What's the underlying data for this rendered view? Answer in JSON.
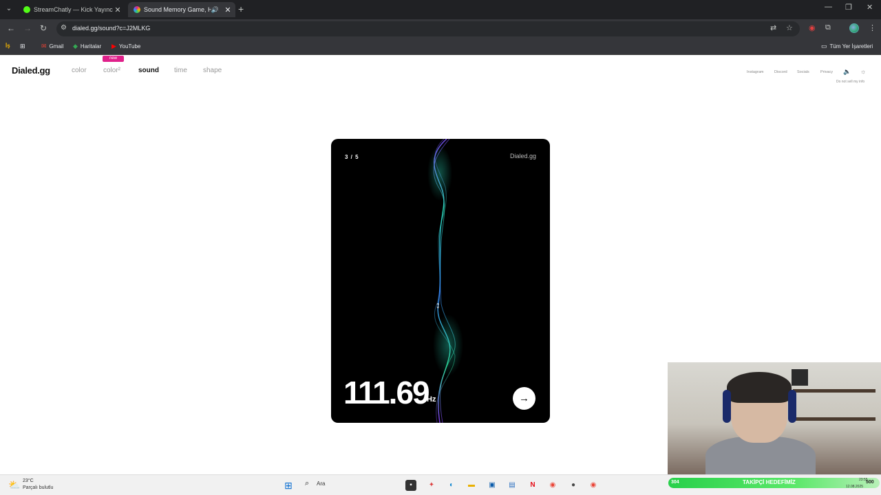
{
  "browser": {
    "tabs": [
      {
        "title": "StreamChatly — Kick Yayıncıları",
        "favicon_color": "#53fc18"
      },
      {
        "title": "Sound Memory Game, How",
        "favicon_color": "#e0208a",
        "active": true
      }
    ],
    "url": "dialed.gg/sound?c=J2MLKG",
    "bookmarks": [
      {
        "label": "İş"
      },
      {
        "label": "Gmail"
      },
      {
        "label": "Haritalar"
      },
      {
        "label": "YouTube"
      }
    ],
    "all_bookmarks": "Tüm Yer İşaretleri"
  },
  "site": {
    "logo": "Dialed.gg",
    "nav": [
      {
        "label": "color"
      },
      {
        "label": "color²"
      },
      {
        "label": "sound"
      },
      {
        "label": "time"
      },
      {
        "label": "shape"
      }
    ],
    "new_badge": "new",
    "header_links": [
      {
        "label": "Instagram"
      },
      {
        "label": "Discord"
      },
      {
        "label": "Socials"
      },
      {
        "label": "Privacy"
      }
    ],
    "do_not_sell": "Do not sell my info"
  },
  "game": {
    "counter": "3 / 5",
    "card_logo": "Dialed.gg",
    "frequency": "111.69",
    "unit": "Hz",
    "next_label": "→"
  },
  "taskbar": {
    "temperature": "23°C",
    "weather": "Parçalı bulutlu",
    "search_placeholder": "Ara",
    "goal_count": "304",
    "goal_label": "TAKİPÇİ HEDEFİMİZ",
    "goal_target": "500",
    "time": "23:55",
    "date": "12.08.2025"
  }
}
